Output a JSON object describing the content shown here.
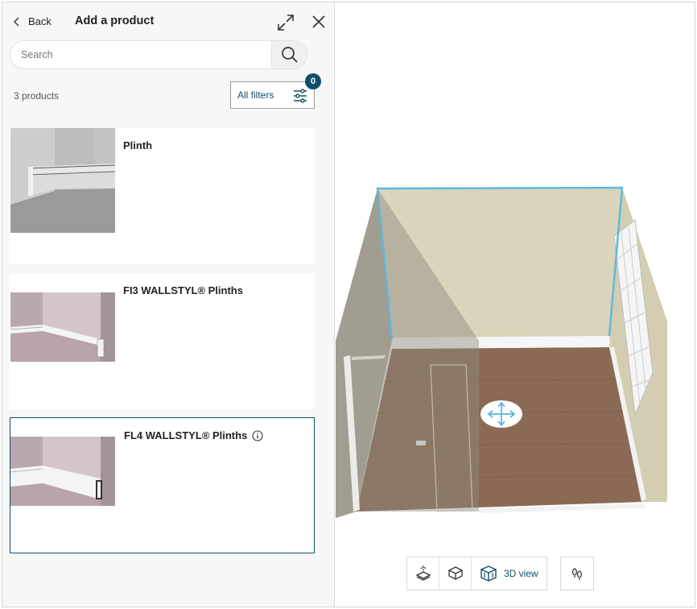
{
  "header": {
    "back_label": "Back",
    "title": "Add a product"
  },
  "search": {
    "placeholder": "Search",
    "value": ""
  },
  "results": {
    "count_label": "3 products",
    "filters_label": "All filters",
    "filters_count": "0"
  },
  "products": [
    {
      "name": "Plinth",
      "selected": false,
      "has_info": false
    },
    {
      "name": "FI3 WALLSTYL® Plinths",
      "selected": false,
      "has_info": false
    },
    {
      "name": "FL4 WALLSTYL® Plinths",
      "selected": true,
      "has_info": true
    }
  ],
  "toolbar": {
    "view_3d_label": "3D view"
  },
  "colors": {
    "accent": "#0f4f6b",
    "wall_highlight": "#5ab8e0",
    "floor": "#8a6a55",
    "wall": "#d9d4bb"
  },
  "icons": {
    "back": "chevron-left-icon",
    "expand": "expand-icon",
    "close": "close-icon",
    "search": "search-icon",
    "filters": "sliders-icon",
    "info": "info-icon",
    "move": "move-arrows-icon",
    "floor_view": "floor-plan-icon",
    "box_view": "box-view-icon",
    "view_3d": "cube-3d-icon",
    "walk": "footsteps-icon"
  }
}
